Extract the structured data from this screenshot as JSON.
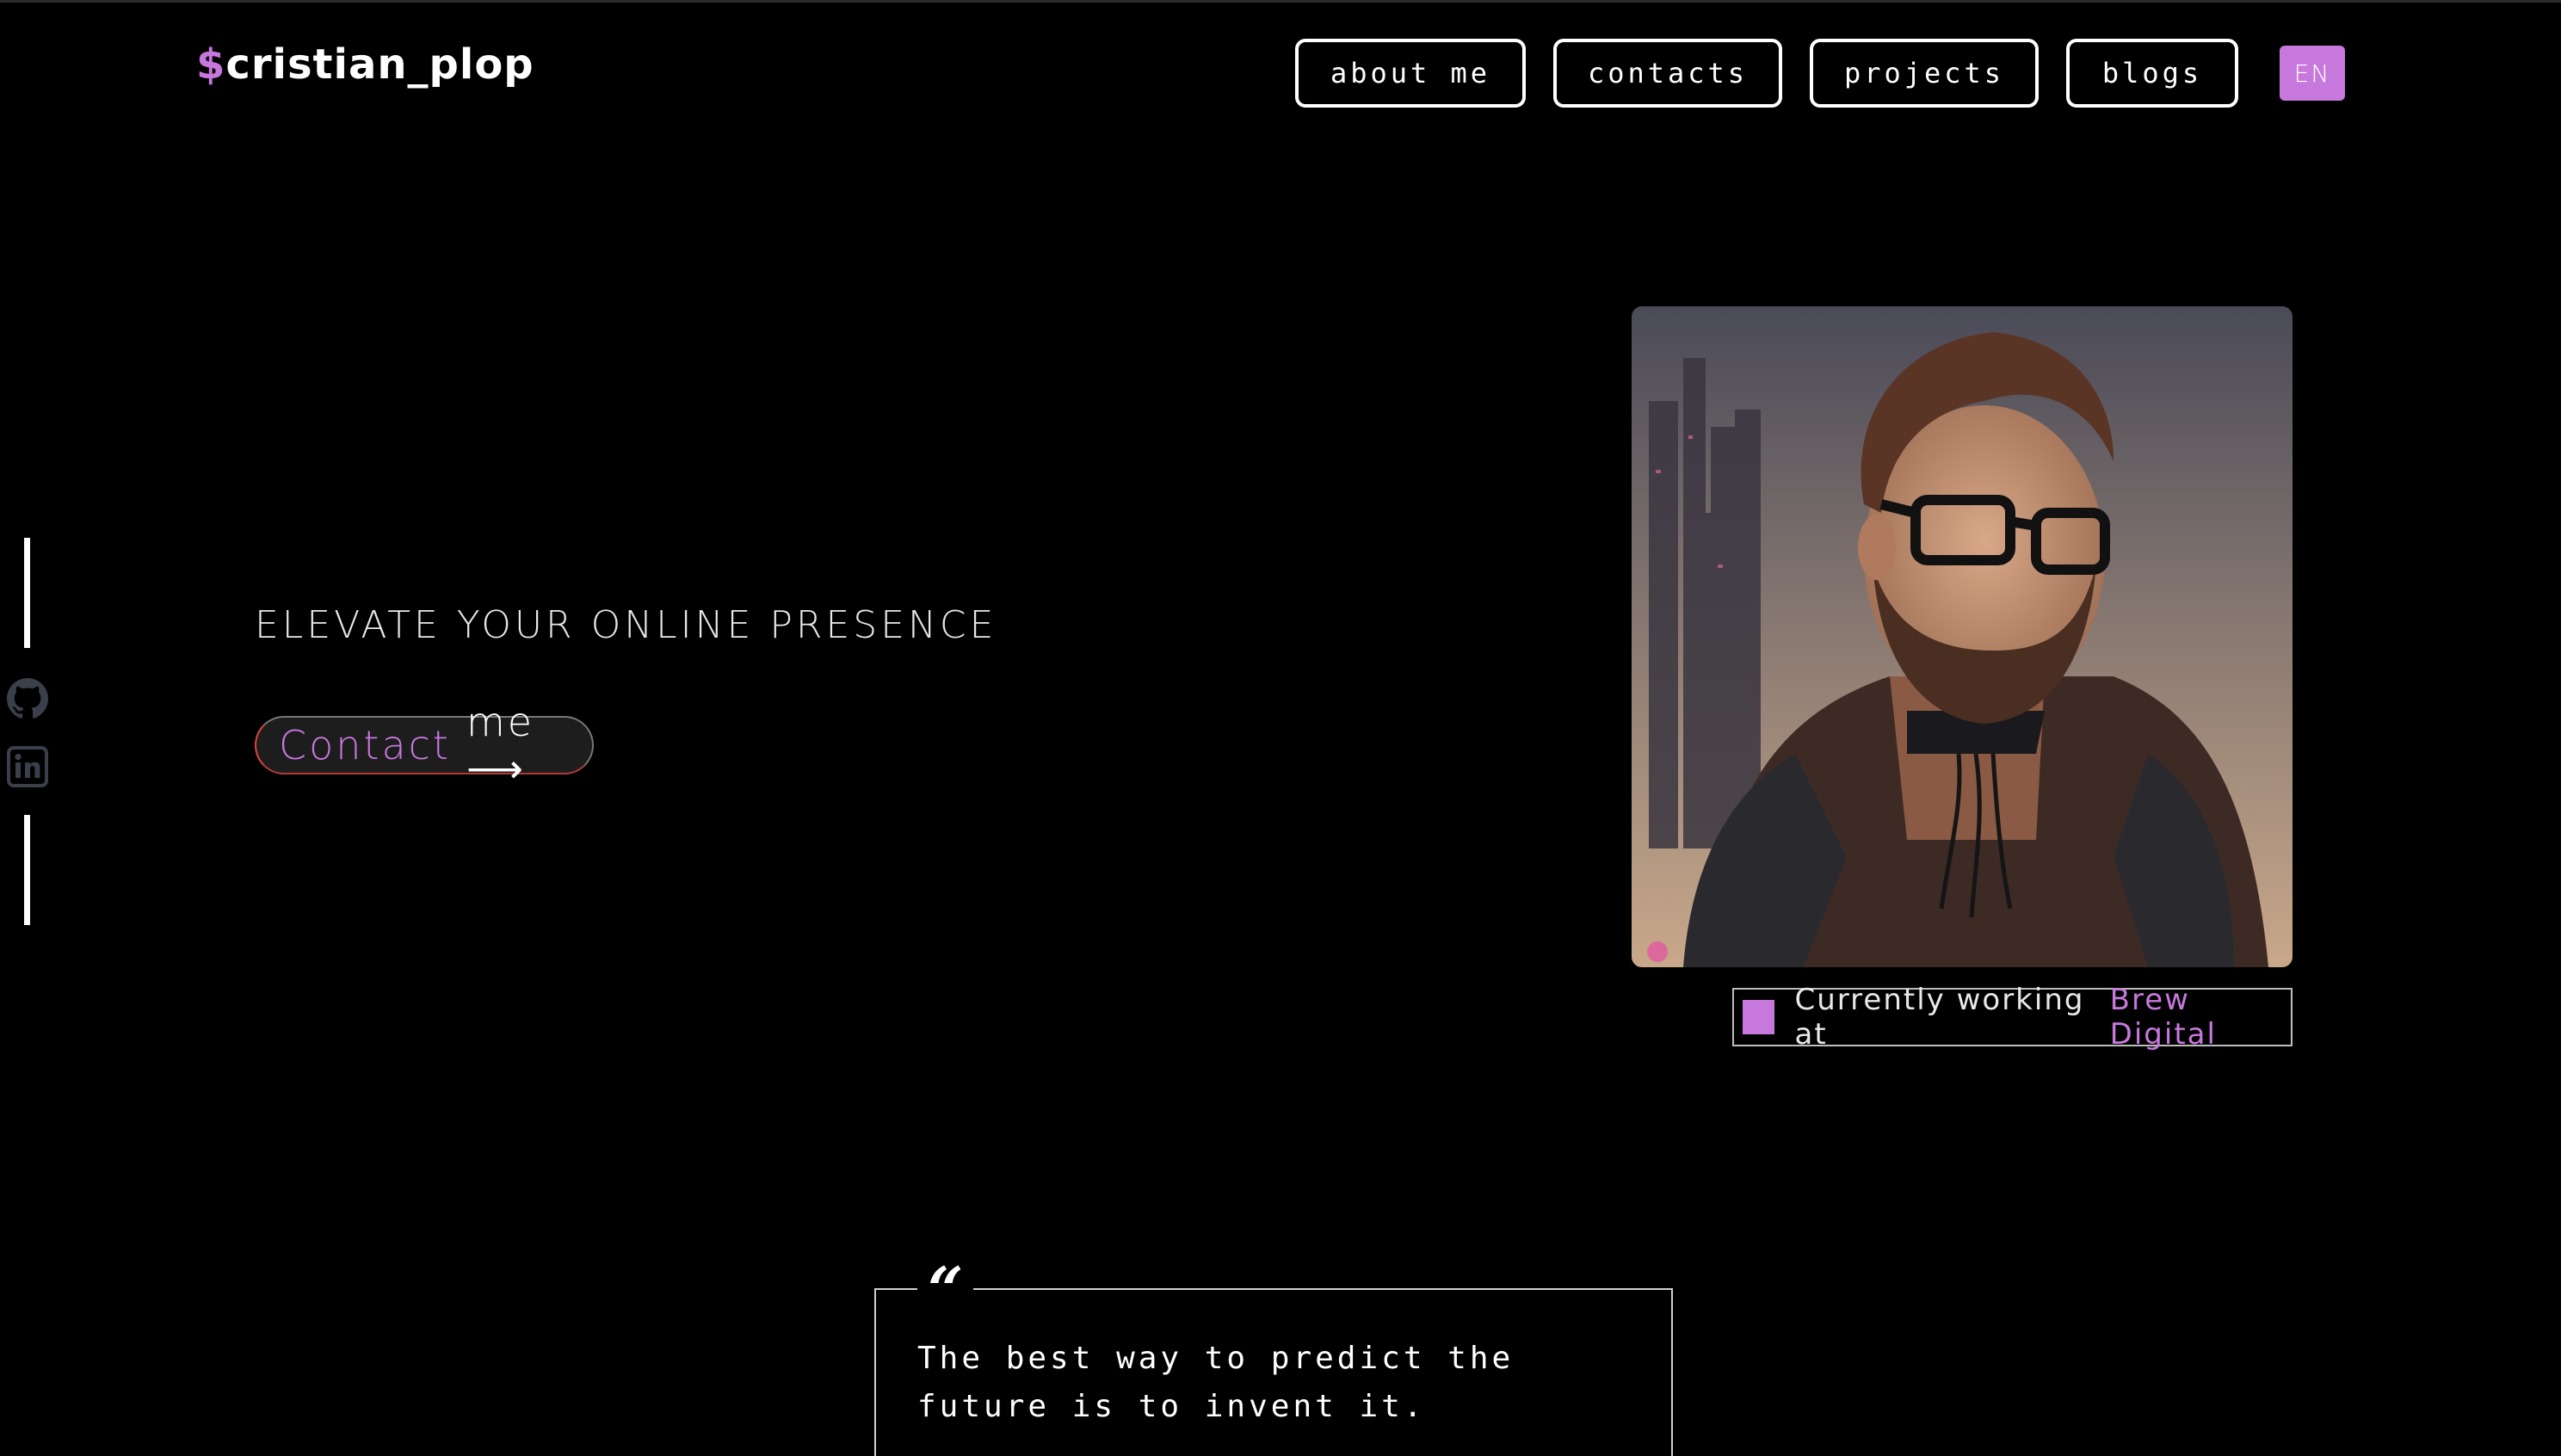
{
  "header": {
    "logo_symbol": "$",
    "logo_text": "cristian_plop",
    "nav": {
      "about": "about me",
      "contacts": "contacts",
      "projects": "projects",
      "blogs": "blogs"
    },
    "language": "EN"
  },
  "social": {
    "icons": [
      "github-icon",
      "linkedin-icon"
    ]
  },
  "hero": {
    "tagline": "ELEVATE YOUR ONLINE PRESENCE",
    "contact_word": "Contact",
    "contact_rest": "me ⟶"
  },
  "status": {
    "prefix": "Currently working at",
    "company": "Brew Digital"
  },
  "quote": {
    "mark": "“",
    "text": "The best way to predict the future is to invent it."
  },
  "colors": {
    "accent": "#c778dd",
    "background": "#000000",
    "text": "#ffffff"
  }
}
